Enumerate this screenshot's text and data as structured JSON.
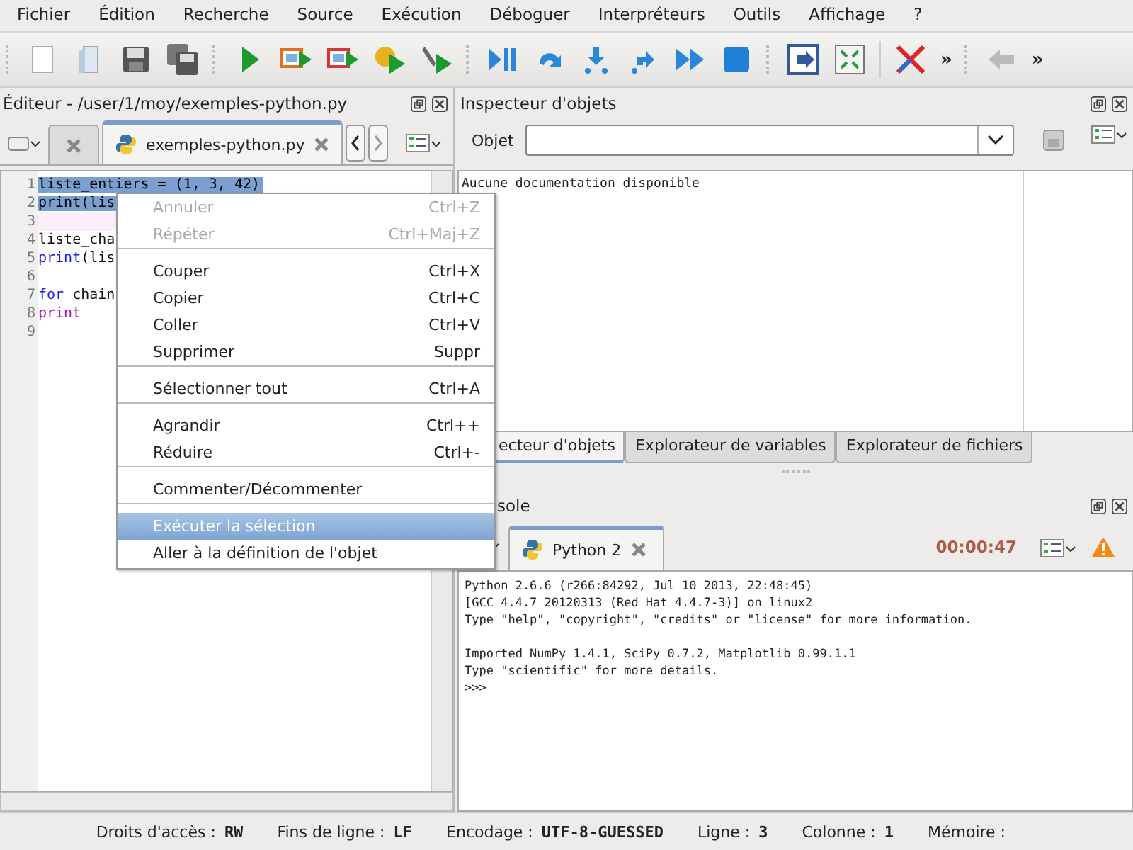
{
  "menu_bar": [
    "Fichier",
    "Édition",
    "Recherche",
    "Source",
    "Exécution",
    "Déboguer",
    "Interpréteurs",
    "Outils",
    "Affichage",
    "?"
  ],
  "toolbar": {
    "overflow": [
      "»",
      "»"
    ]
  },
  "editor": {
    "title": "Éditeur - /user/1/moy/exemples-python.py",
    "tabs": [
      {
        "label": "exemples-python.py",
        "selected": true
      }
    ],
    "lines": [
      {
        "number": "1",
        "selected": true,
        "current": false,
        "tokens": [
          {
            "text": "liste_entiers = (1, 3, 42)",
            "kind": "plain"
          }
        ]
      },
      {
        "number": "2",
        "selected": true,
        "current": false,
        "tokens": [
          {
            "text": "print(lis",
            "kind": "plain"
          }
        ]
      },
      {
        "number": "3",
        "selected": false,
        "current": true
      },
      {
        "number": "4",
        "selected": false,
        "current": false,
        "tokens": [
          {
            "text": "liste_cha",
            "kind": "plain"
          }
        ]
      },
      {
        "number": "5",
        "selected": false,
        "current": false,
        "tokens": [
          {
            "text": "print",
            "kind": "keyword"
          },
          {
            "text": "(lis",
            "kind": "plain"
          }
        ]
      },
      {
        "number": "6",
        "selected": false,
        "current": false
      },
      {
        "number": "7",
        "selected": false,
        "current": false,
        "tokens": [
          {
            "text": "for",
            "kind": "keyword"
          },
          {
            "text": " chain",
            "kind": "plain"
          }
        ]
      },
      {
        "number": "8",
        "selected": false,
        "current": false,
        "tokens": [
          {
            "text": "    print",
            "kind": "call"
          }
        ]
      },
      {
        "number": "9",
        "selected": false,
        "current": false
      }
    ]
  },
  "inspector": {
    "title": "Inspecteur d'objets",
    "object_label": "Objet",
    "message": "Aucune documentation disponible"
  },
  "bottom_tabs": [
    {
      "label": "ecteur d'objets",
      "selected": true
    },
    {
      "label": "Explorateur de variables",
      "selected": false
    },
    {
      "label": "Explorateur de fichiers",
      "selected": false
    }
  ],
  "console": {
    "title": "sole",
    "tabs": [
      {
        "label": "Python 2",
        "selected": true
      }
    ],
    "timer": "00:00:47",
    "output": [
      [
        "Python 2.6.6 (r266:84292, Jul 10 2013, 22:48:45)",
        "[GCC 4.4.7 20120313 (Red Hat 4.4.7-3)] on linux2",
        "Type \"help\", \"copyright\", \"credits\" or \"license\" for more information."
      ],
      [
        "Imported NumPy 1.4.1, SciPy 0.7.2, Matplotlib 0.99.1.1",
        "Type \"scientific\" for more details.",
        ">>>"
      ]
    ]
  },
  "context_menu": {
    "sections": [
      [
        {
          "label": "Annuler",
          "shortcut": "Ctrl+Z",
          "disabled": true,
          "selected": false
        },
        {
          "label": "Répéter",
          "shortcut": "Ctrl+Maj+Z",
          "disabled": true,
          "selected": false
        }
      ],
      [
        {
          "label": "Couper",
          "shortcut": "Ctrl+X",
          "disabled": false,
          "selected": false
        },
        {
          "label": "Copier",
          "shortcut": "Ctrl+C",
          "disabled": false,
          "selected": false
        },
        {
          "label": "Coller",
          "shortcut": "Ctrl+V",
          "disabled": false,
          "selected": false
        },
        {
          "label": "Supprimer",
          "shortcut": "Suppr",
          "disabled": false,
          "selected": false
        }
      ],
      [
        {
          "label": "Sélectionner tout",
          "shortcut": "Ctrl+A",
          "disabled": false,
          "selected": false
        }
      ],
      [
        {
          "label": "Agrandir",
          "shortcut": "Ctrl++",
          "disabled": false,
          "selected": false
        },
        {
          "label": "Réduire",
          "shortcut": "Ctrl+-",
          "disabled": false,
          "selected": false
        }
      ],
      [
        {
          "label": "Commenter/Décommenter",
          "disabled": false,
          "selected": false
        }
      ],
      [
        {
          "label": "Exécuter la sélection",
          "disabled": false,
          "selected": true
        },
        {
          "label": "Aller à la définition de l'objet",
          "disabled": false,
          "selected": false
        }
      ]
    ]
  },
  "status_bar": [
    {
      "label": "Droits d'accès :",
      "value": "RW"
    },
    {
      "label": "Fins de ligne :",
      "value": "LF"
    },
    {
      "label": "Encodage :",
      "value": "UTF-8-GUESSED"
    },
    {
      "label": "Ligne :",
      "value": "3"
    },
    {
      "label": "Colonne :",
      "value": "1"
    },
    {
      "label": "Mémoire :"
    }
  ]
}
